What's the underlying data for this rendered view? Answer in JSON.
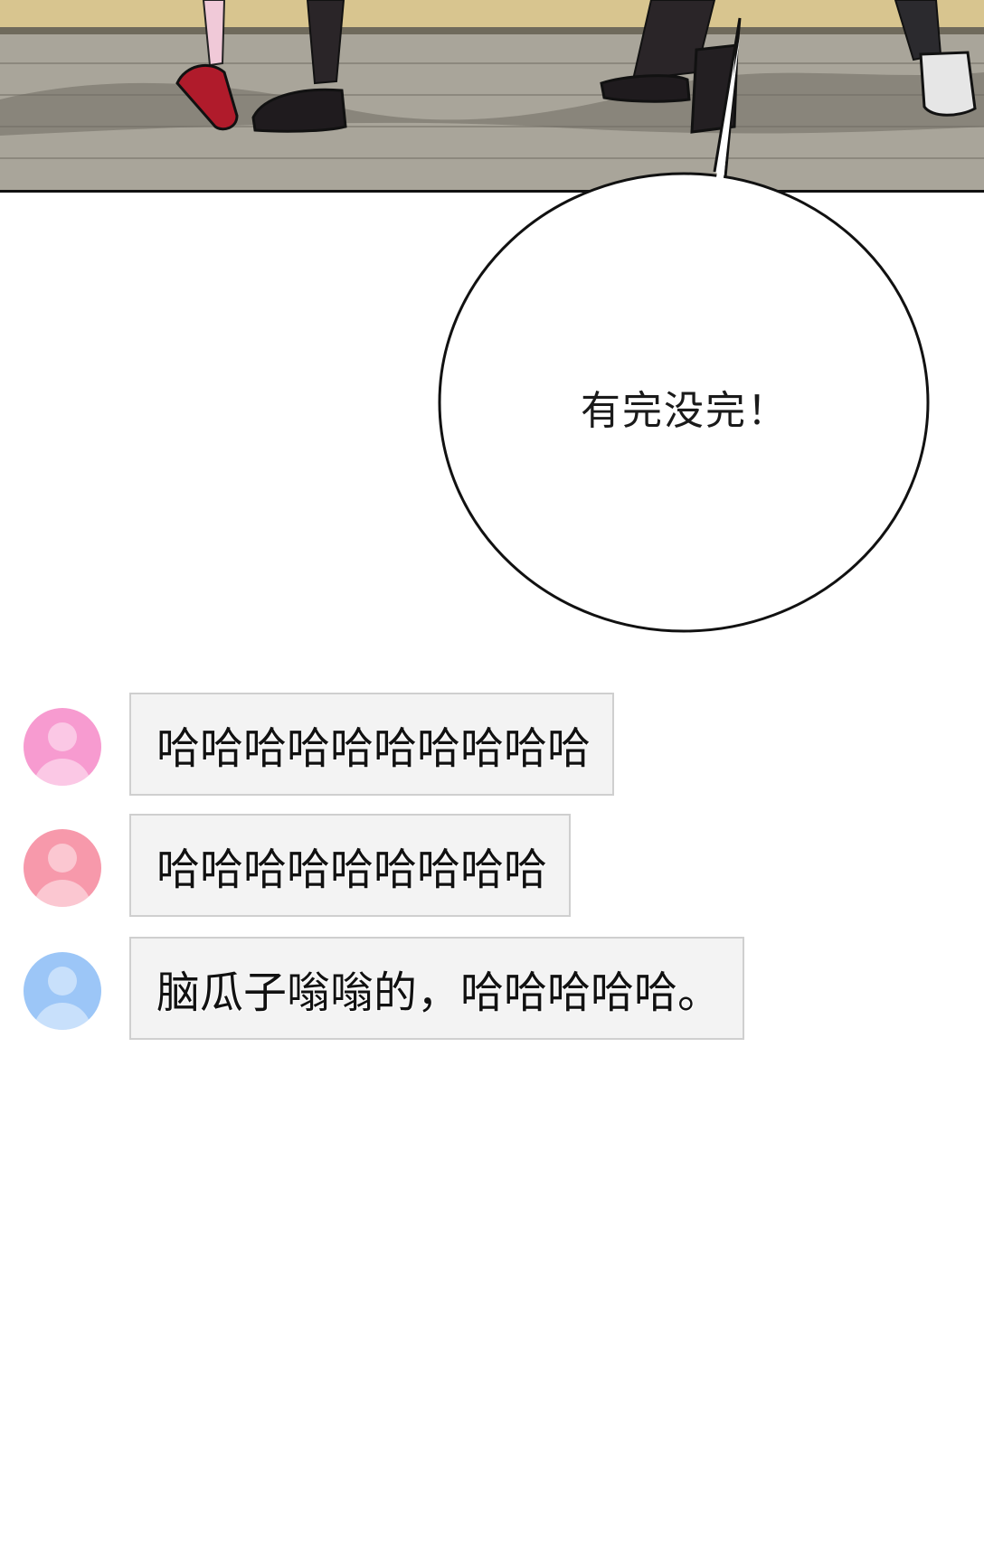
{
  "bubble": {
    "text": "有完没完！"
  },
  "comments": [
    {
      "text": "哈哈哈哈哈哈哈哈哈哈",
      "avatar_color": "#f79bd0"
    },
    {
      "text": "哈哈哈哈哈哈哈哈哈",
      "avatar_color": "#f799ab"
    },
    {
      "text": "脑瓜子嗡嗡的，哈哈哈哈哈。",
      "avatar_color": "#9cc6f7"
    }
  ]
}
